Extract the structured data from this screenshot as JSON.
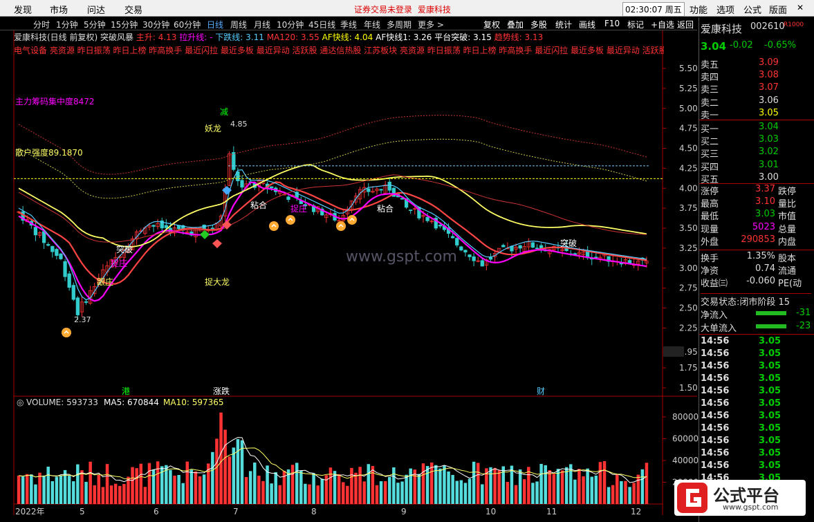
{
  "menu": {
    "items": [
      "发现",
      "市场",
      "问达",
      "交易"
    ],
    "login": "证券交易未登录",
    "stock": "爱康科技",
    "time": "02:30:07 周五",
    "right": [
      "功能",
      "选项",
      "公式",
      "版面"
    ]
  },
  "periods": [
    "分时",
    "1分钟",
    "5分钟",
    "15分钟",
    "30分钟",
    "60分钟",
    "日线",
    "周线",
    "月线",
    "10分钟",
    "45日线",
    "季线",
    "年线",
    "多周期",
    "更多 >"
  ],
  "tools": [
    "复权",
    "叠加",
    "多股",
    "统计",
    "画线",
    "F10",
    "标记",
    "+自选",
    "返回"
  ],
  "info": {
    "title": "爱康科技(日线 前复权)",
    "formula": "突破风暴",
    "up": "主升: 4.13",
    "pull": "拉升线: -",
    "down": "下跌线: 3.11",
    "ma120": "MA120: 3.55",
    "af": "AF快线: 4.04",
    "af1": "AF快线1: 3.26",
    "plat": "平台突破: 3.15",
    "trend": "趋势线: 3.13"
  },
  "ticker": "电气设备 亮资源 昨日振荡 昨日上榜 昨高换手 最近闪拉 最近多板 最近异动 活跃股 通达信热股 江苏板块 亮资源 昨日振荡 昨日上榜 昨高换手 最近闪拉 最近多板 最近异动 活跃股 通",
  "annotations": {
    "chip": "主力筹码集中度8472",
    "retail": "散户强度89.1870",
    "high": "4.85",
    "low": "2.37",
    "dragon": "妖龙",
    "cut": "减",
    "follow": "跟庄",
    "catch": "捉庄",
    "bigdragon": "捉大龙",
    "break": "突破",
    "stick": "粘合",
    "port": "港",
    "zd": "涨跌",
    "cai": "财",
    "watermark": "www.gspt.com"
  },
  "yaxis": [
    "5.50",
    "5.25",
    "5.00",
    "4.75",
    "4.50",
    "4.25",
    "4.00",
    "3.75",
    "3.50",
    "3.25",
    "3.00",
    "2.75",
    "2.50",
    "2.25",
    "1.95",
    "1.75",
    "1.50"
  ],
  "vaxis": [
    "80000",
    "60000",
    "40000",
    "20000"
  ],
  "volume": {
    "label": "VOLUME: 593733",
    "ma5": "MA5: 670844",
    "ma10": "MA10: 597365"
  },
  "xaxis": [
    "2022年",
    "5",
    "6",
    "7",
    "8",
    "9",
    "10",
    "11",
    "12"
  ],
  "quote": {
    "name": "爱康科技",
    "code": "002610",
    "price": "3.04",
    "chg": "-0.02",
    "pct": "-0.65%",
    "asks": [
      [
        "卖五",
        "3.09"
      ],
      [
        "卖四",
        "3.08"
      ],
      [
        "卖三",
        "3.07"
      ],
      [
        "卖二",
        "3.06"
      ],
      [
        "卖一",
        "3.05"
      ]
    ],
    "bids": [
      [
        "买一",
        "3.04"
      ],
      [
        "买二",
        "3.03"
      ],
      [
        "买三",
        "3.02"
      ],
      [
        "买四",
        "3.01"
      ],
      [
        "买五",
        "3.00"
      ]
    ],
    "stats": [
      [
        "涨停",
        "3.37",
        "跌停"
      ],
      [
        "最高",
        "3.10",
        "量比"
      ],
      [
        "最低",
        "3.03",
        "市值"
      ],
      [
        "现量",
        "5023",
        "总量"
      ],
      [
        "外盘",
        "290853",
        "内盘"
      ]
    ],
    "ext": [
      [
        "换手",
        "1.35%",
        "股本"
      ],
      [
        "净资",
        "0.74",
        "流通"
      ],
      [
        "收益㈢",
        "-0.060",
        "PE(动"
      ]
    ],
    "state": "交易状态:闭市阶段 15",
    "flow": [
      [
        "净流入",
        "-31"
      ],
      [
        "大单流入",
        "-23"
      ]
    ],
    "ticks": [
      [
        "14:56",
        "3.05"
      ],
      [
        "14:56",
        "3.05"
      ],
      [
        "14:56",
        "3.05"
      ],
      [
        "14:56",
        "3.05"
      ],
      [
        "14:56",
        "3.05"
      ],
      [
        "14:56",
        "3.05"
      ],
      [
        "14:56",
        "3.05"
      ],
      [
        "14:56",
        "3.05"
      ],
      [
        "14:56",
        "3.05"
      ],
      [
        "14:56",
        "3.05"
      ],
      [
        "14:56",
        "3.05"
      ],
      [
        "14:56",
        "3.05"
      ]
    ]
  },
  "logo": {
    "text": "公式平台",
    "url": "www.gspt.com"
  }
}
